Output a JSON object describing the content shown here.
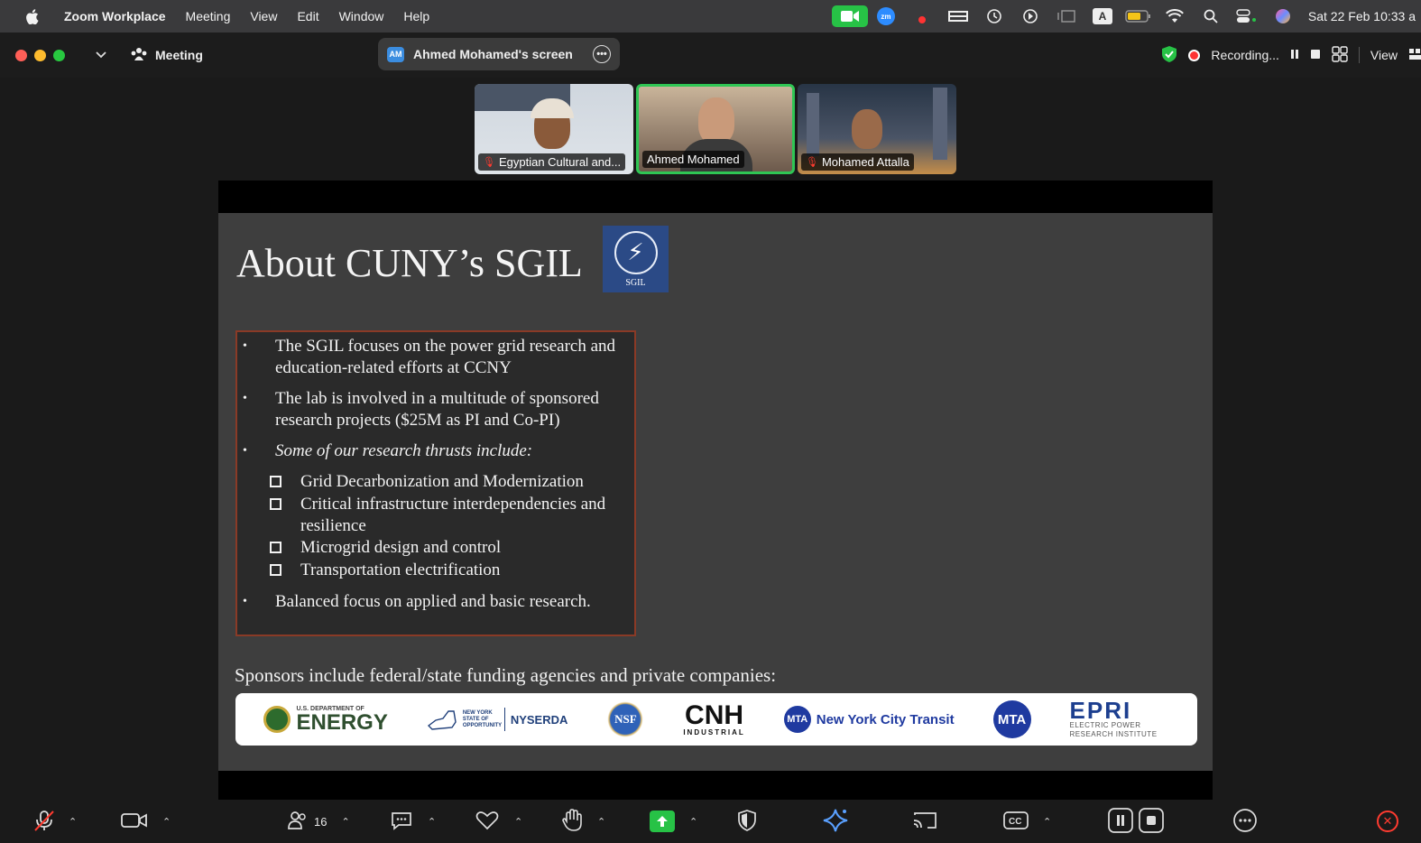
{
  "menubar": {
    "app_name": "Zoom Workplace",
    "items": [
      "Meeting",
      "View",
      "Edit",
      "Window",
      "Help"
    ],
    "clock": "Sat 22 Feb  10:33 a"
  },
  "titlebar": {
    "meeting_label": "Meeting",
    "share_badge": "AM",
    "share_title": "Ahmed Mohamed's screen",
    "recording_label": "Recording...",
    "view_label": "View"
  },
  "participants": [
    {
      "name": "Egyptian Cultural and...",
      "muted": true
    },
    {
      "name": "Ahmed Mohamed",
      "muted": false,
      "active_speaker": true
    },
    {
      "name": "Mohamed Attalla",
      "muted": true
    }
  ],
  "slide": {
    "title": "About CUNY’s SGIL",
    "logo_label": "SGIL",
    "bullets": [
      "The SGIL focuses on the power grid research and education-related efforts at CCNY",
      "The lab is involved in a multitude of sponsored research projects ($25M as PI and Co-PI)",
      "Some of our research thrusts include:"
    ],
    "thrusts": [
      "Grid Decarbonization and Modernization",
      "Critical infrastructure interdependencies and resilience",
      "Microgrid design and control",
      "Transportation electrification"
    ],
    "last_bullet": "Balanced focus on applied and basic research.",
    "sponsors_text": "Sponsors include federal/state funding agencies and private companies:",
    "sponsor_logos": {
      "doe_small": "U.S. DEPARTMENT OF",
      "doe": "ENERGY",
      "nys_small": "NEW YORK STATE OF OPPORTUNITY",
      "nyserda": "NYSERDA",
      "nsf": "NSF",
      "cnh": "CNH",
      "cnh_small": "INDUSTRIAL",
      "mta": "MTA",
      "nyct": "New York City Transit",
      "epri": "EPRI",
      "epri_small": "ELECTRIC POWER RESEARCH INSTITUTE"
    }
  },
  "toolbar": {
    "participant_count": "16"
  },
  "colors": {
    "active_speaker": "#2fc654",
    "share_green": "#27c246",
    "end_red": "#ff3b30",
    "slide_bg": "#3e3e3e",
    "bullet_border": "#8a3a26"
  }
}
